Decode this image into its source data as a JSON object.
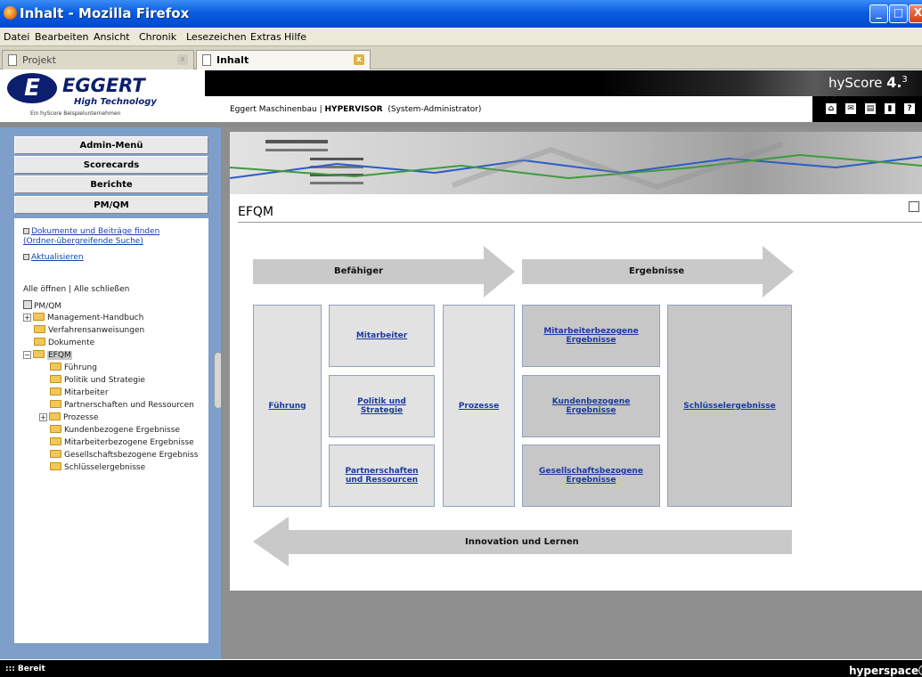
{
  "window": {
    "title": "Inhalt - Mozilla Firefox",
    "btn_min": "_",
    "btn_max": "□",
    "btn_close": "X"
  },
  "menu": [
    "Datei",
    "Bearbeiten",
    "Ansicht",
    "Chronik",
    "Lesezeichen",
    "Extras",
    "Hilfe"
  ],
  "tabs": [
    {
      "label": "Projekt",
      "active": false
    },
    {
      "label": "Inhalt",
      "active": true
    }
  ],
  "tab_close": "x",
  "header": {
    "logo_mark": "E",
    "logo_name": "EGGERT",
    "logo_sub": "High Technology",
    "logo_tagline": "Ein hyScore Beispielunternehmen",
    "app_name": "hyScore",
    "app_version_major": "4.",
    "app_version_minor": "3",
    "user_company": "Eggert Maschinenbau |",
    "user_project": "HYPERVISOR",
    "user_role": "(System-Administrator)",
    "nav_icons": [
      "home-icon",
      "mail-icon",
      "print-icon",
      "book-icon",
      "help-icon"
    ],
    "nav_help_glyph": "?"
  },
  "sidebar": {
    "menus": [
      "Admin-Menü",
      "Scorecards",
      "Berichte",
      "PM/QM"
    ],
    "links": [
      "Dokumente und Beiträge finden",
      "(Ordner-übergreifende Suche)",
      "Aktualisieren"
    ],
    "expand_all": "Alle öffnen | Alle schließen",
    "tree_root": "PM/QM",
    "tree": [
      {
        "label": "Management-Handbuch",
        "expander": "+",
        "level": 1
      },
      {
        "label": "Verfahrensanweisungen",
        "level": 1
      },
      {
        "label": "Dokumente",
        "level": 1
      },
      {
        "label": "EFQM",
        "expander": "−",
        "level": 1,
        "selected": true
      },
      {
        "label": "Führung",
        "level": 2
      },
      {
        "label": "Politik und Strategie",
        "level": 2
      },
      {
        "label": "Mitarbeiter",
        "level": 2
      },
      {
        "label": "Partnerschaften und Ressourcen",
        "level": 2
      },
      {
        "label": "Prozesse",
        "expander": "+",
        "level": 2
      },
      {
        "label": "Kundenbezogene Ergebnisse",
        "level": 2
      },
      {
        "label": "Mitarbeiterbezogene Ergebnisse",
        "level": 2
      },
      {
        "label": "Gesellschaftsbezogene Ergebniss",
        "level": 2
      },
      {
        "label": "Schlüsselergebnisse",
        "level": 2
      }
    ]
  },
  "content": {
    "title": "EFQM",
    "arrow_enablers": "Befähiger",
    "arrow_results": "Ergebnisse",
    "arrow_innovation": "Innovation und Lernen",
    "cells": {
      "fuehrung": "Führung",
      "mitarbeiter": "Mitarbeiter",
      "politik": "Politik und Strategie",
      "partnerschaften": "Partnerschaften und Ressourcen",
      "prozesse": "Prozesse",
      "mitarbeiter_ergebnisse": "Mitarbeiterbezogene Ergebnisse",
      "kunden_ergebnisse": "Kundenbezogene Ergebnisse",
      "gesellschaft_ergebnisse": "Gesellschaftsbezogene Ergebnisse",
      "schluessel_ergebnisse": "Schlüsselergebnisse"
    }
  },
  "statusbar": {
    "text": "::: Bereit",
    "brand": "hyperspace"
  },
  "colors": {
    "titlebar": "#0a5de0",
    "sidebar": "#7d9fca",
    "link": "#1b3a9e",
    "cell_light": "#e2e2e2",
    "cell_dark": "#c7c7c7",
    "arrow": "#c9c9c9"
  }
}
